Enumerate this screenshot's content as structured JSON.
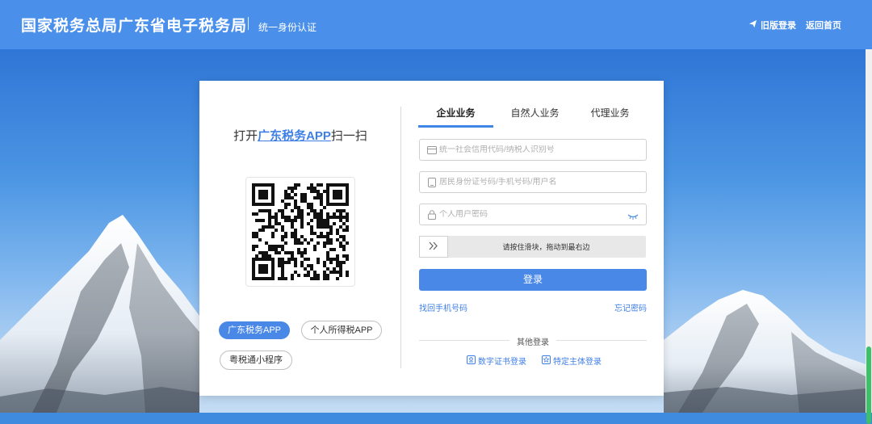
{
  "header": {
    "title": "国家税务总局广东省电子税务局",
    "subtitle": "统一身份认证",
    "nav": {
      "old_login": "旧版登录",
      "home": "返回首页"
    }
  },
  "qr": {
    "prefix": "打开",
    "brand": "广东税务APP",
    "suffix": "扫一扫"
  },
  "apps": {
    "gd_tax_app": "广东税务APP",
    "personal_tax_app": "个人所得税APP",
    "mini_program": "粤税通小程序"
  },
  "tabs": [
    {
      "label": "企业业务",
      "active": true
    },
    {
      "label": "自然人业务",
      "active": false
    },
    {
      "label": "代理业务",
      "active": false
    }
  ],
  "form": {
    "credit_code_placeholder": "统一社会信用代码/纳税人识别号",
    "id_placeholder": "居民身份证号码/手机号码/用户名",
    "password_placeholder": "个人用户密码",
    "slider_hint": "请按住滑块，拖动到最右边",
    "login": "登录",
    "retrieve_phone": "找回手机号码",
    "forgot_password": "忘记密码",
    "other_login": "其他登录",
    "cert_login": "数字证书登录",
    "entity_login": "特定主体登录"
  },
  "colors": {
    "header_bg": "#4a90ea",
    "accent": "#4a88e8",
    "link": "#3f7fe5"
  }
}
